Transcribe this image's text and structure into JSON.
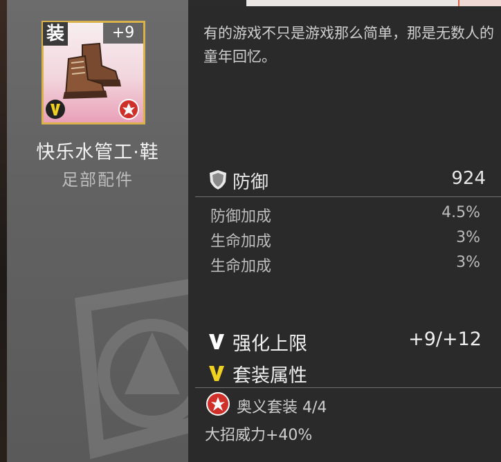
{
  "item": {
    "equip_tag": "装",
    "level": "+9",
    "name": "快乐水管工·鞋",
    "type": "足部配件"
  },
  "description": "有的游戏不只是游戏那么简单，那是无数人的童年回忆。",
  "main_stat": {
    "icon": "shield-icon",
    "label": "防御",
    "value": "924"
  },
  "sub_stats": [
    {
      "label": "防御加成",
      "value": "4.5%"
    },
    {
      "label": "生命加成",
      "value": "3%"
    },
    {
      "label": "生命加成",
      "value": "3%"
    }
  ],
  "enhance": {
    "label": "强化上限",
    "value": "+9/+12"
  },
  "set_attr": {
    "label": "套装属性"
  },
  "set": {
    "name": "奥义套装 4/4",
    "bonus": "大招威力+40%"
  },
  "colors": {
    "card_border": "#d9b24c",
    "tier_badge": "#f0d020",
    "set_badge": "#d0302a"
  }
}
